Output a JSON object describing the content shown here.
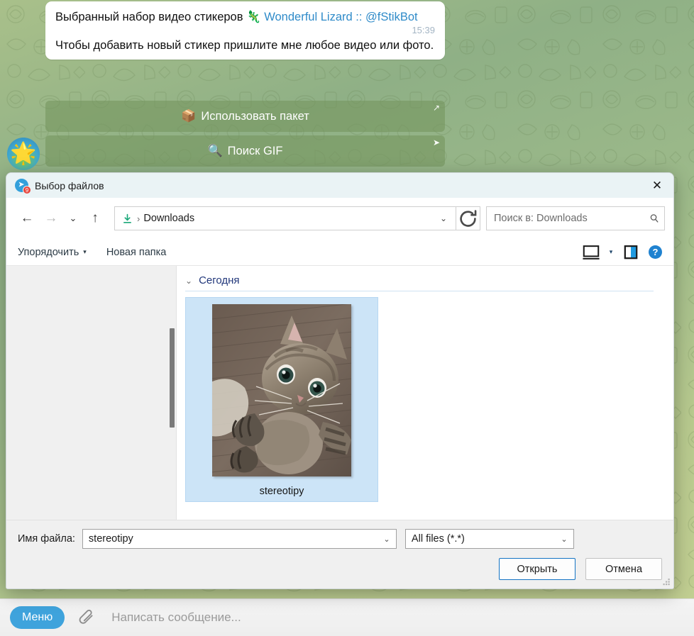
{
  "telegram": {
    "message": {
      "line1_prefix": "Выбранный набор видео стикеров ",
      "line1_emoji": "🦎",
      "line1_link": "Wonderful Lizard :: @fStikBot",
      "line2": "Чтобы добавить новый стикер пришлите мне любое видео или фото.",
      "time": "15:39"
    },
    "keyboard": [
      {
        "emoji": "📦",
        "label": "Использовать пакет",
        "corner": "↗"
      },
      {
        "emoji": "🔍",
        "label": "Поиск GIF",
        "corner": "➤"
      }
    ],
    "avatar_emoji": "🌟",
    "composer": {
      "menu_label": "Меню",
      "placeholder": "Написать сообщение...",
      "attach_icon": "paperclip-icon"
    },
    "colors": {
      "accent": "#3fa3dc",
      "link": "#2f8bc9",
      "keyboard_bg": "rgba(118,150,96,.62)"
    }
  },
  "dialog": {
    "title": "Выбор файлов",
    "app_icon": "telegram-icon",
    "badge_count": "9",
    "close_icon": "✕",
    "nav": {
      "back_icon": "←",
      "forward_icon": "→",
      "recent_icon": "⌄",
      "up_icon": "↑",
      "breadcrumb_icon": "download-icon",
      "breadcrumb_separator": "›",
      "breadcrumb_label": "Downloads",
      "breadcrumb_caret": "⌄",
      "refresh_icon": "refresh-icon",
      "search_placeholder": "Поиск в: Downloads",
      "search_icon": "search-icon"
    },
    "commandbar": {
      "organize_label": "Упорядочить",
      "organize_caret": "▾",
      "new_folder_label": "Новая папка",
      "view_icon": "monitor-view-icon",
      "view_caret": "▾",
      "preview_pane_icon": "preview-pane-icon",
      "help_label": "?"
    },
    "filelist": {
      "group_chevron": "⌄",
      "group_label": "Сегодня",
      "item": {
        "name": "stereotipy",
        "thumbnail": "cat-photo-thumbnail",
        "selected": true
      }
    },
    "footer": {
      "filename_label": "Имя файла:",
      "filename_value": "stereotipy",
      "filename_caret": "⌄",
      "filetype_value": "All files (*.*)",
      "filetype_caret": "⌄",
      "open_label": "Открыть",
      "cancel_label": "Отмена"
    },
    "colors": {
      "titlebar_bg": "#eaf3f5",
      "selection_bg": "#cce4f7",
      "primary_border": "#1474c4",
      "help_bg": "#1f82d0",
      "group_text": "#21377a"
    }
  }
}
